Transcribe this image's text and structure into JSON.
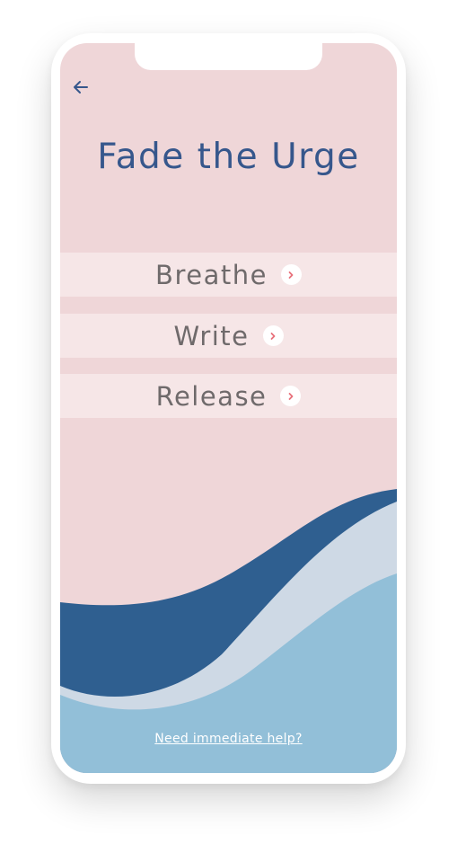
{
  "screen": {
    "title": "Fade the Urge",
    "back_icon": "arrow-left-icon",
    "options": [
      {
        "label": "Breathe",
        "icon": "chevron-right-icon"
      },
      {
        "label": "Write",
        "icon": "chevron-right-icon"
      },
      {
        "label": "Release",
        "icon": "chevron-right-icon"
      }
    ],
    "help_link": "Need immediate help?"
  },
  "colors": {
    "background": "#efd6d8",
    "option_background": "#f6e6e7",
    "title": "#36578c",
    "option_text": "#6f6a6b",
    "chevron": "#e8707a",
    "wave_dark": "#2f5f90",
    "wave_light": "#ced9e5",
    "wave_sky": "#92bfd8"
  }
}
